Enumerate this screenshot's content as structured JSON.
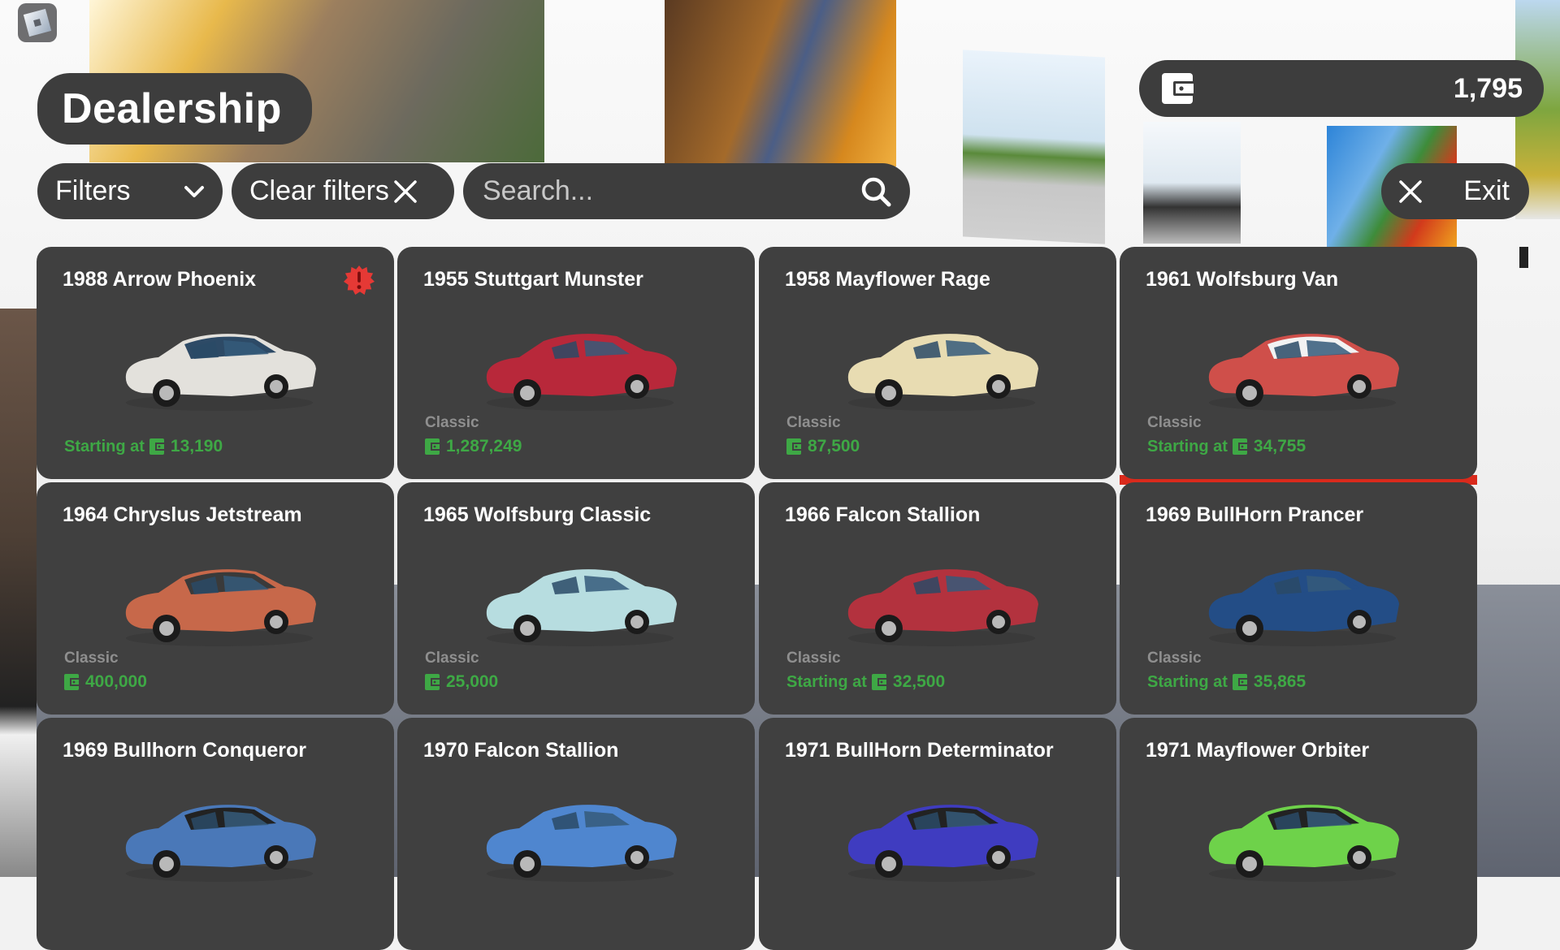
{
  "header": {
    "title": "Dealership",
    "filters_label": "Filters",
    "clear_filters_label": "Clear filters",
    "search_placeholder": "Search...",
    "search_value": "",
    "wallet_amount": "1,795",
    "exit_label": "Exit"
  },
  "colors": {
    "panel": "#3d3d3d",
    "card": "#404040",
    "price_green": "#3ea845",
    "class_gray": "#8f8f8f",
    "alert_red": "#e53935"
  },
  "icons": {
    "logo": "roblox-logo-icon",
    "filters": "chevron-down-icon",
    "clear": "close-icon",
    "search": "search-icon",
    "wallet": "wallet-icon",
    "exit": "close-icon",
    "price": "currency-icon",
    "alert": "alert-badge-icon"
  },
  "cars": [
    {
      "name": "1988 Arrow Phoenix",
      "class": "",
      "price_prefix": "Starting at",
      "price": "13,190",
      "alert": true,
      "color": "#e3e1dc",
      "roof": "#2d4a66"
    },
    {
      "name": "1955 Stuttgart Munster",
      "class": "Classic",
      "price_prefix": "",
      "price": "1,287,249",
      "alert": false,
      "color": "#b8283a",
      "roof": "#b8283a"
    },
    {
      "name": "1958 Mayflower Rage",
      "class": "Classic",
      "price_prefix": "",
      "price": "87,500",
      "alert": false,
      "color": "#e8dcb2",
      "roof": "#e8dcb2"
    },
    {
      "name": "1961 Wolfsburg Van",
      "class": "Classic",
      "price_prefix": "Starting at",
      "price": "34,755",
      "alert": false,
      "color": "#cf4f4a",
      "roof": "#f2f2f2"
    },
    {
      "name": "1964 Chryslus Jetstream",
      "class": "Classic",
      "price_prefix": "",
      "price": "400,000",
      "alert": false,
      "color": "#c7684a",
      "roof": "#3a3a3a"
    },
    {
      "name": "1965 Wolfsburg Classic",
      "class": "Classic",
      "price_prefix": "",
      "price": "25,000",
      "alert": false,
      "color": "#b7dde0",
      "roof": "#b7dde0"
    },
    {
      "name": "1966 Falcon Stallion",
      "class": "Classic",
      "price_prefix": "Starting at",
      "price": "32,500",
      "alert": false,
      "color": "#b3323e",
      "roof": "#b3323e"
    },
    {
      "name": "1969 BullHorn Prancer",
      "class": "Classic",
      "price_prefix": "Starting at",
      "price": "35,865",
      "alert": false,
      "color": "#234d86",
      "roof": "#234d86"
    },
    {
      "name": "1969 Bullhorn Conqueror",
      "class": "",
      "price_prefix": "",
      "price": "",
      "alert": false,
      "color": "#4a78b8",
      "roof": "#222222"
    },
    {
      "name": "1970 Falcon Stallion",
      "class": "",
      "price_prefix": "",
      "price": "",
      "alert": false,
      "color": "#4f86cf",
      "roof": "#4f86cf"
    },
    {
      "name": "1971 BullHorn Determinator",
      "class": "",
      "price_prefix": "",
      "price": "",
      "alert": false,
      "color": "#3f3cc0",
      "roof": "#222222"
    },
    {
      "name": "1971 Mayflower Orbiter",
      "class": "",
      "price_prefix": "",
      "price": "",
      "alert": false,
      "color": "#6ed24a",
      "roof": "#222222"
    }
  ]
}
